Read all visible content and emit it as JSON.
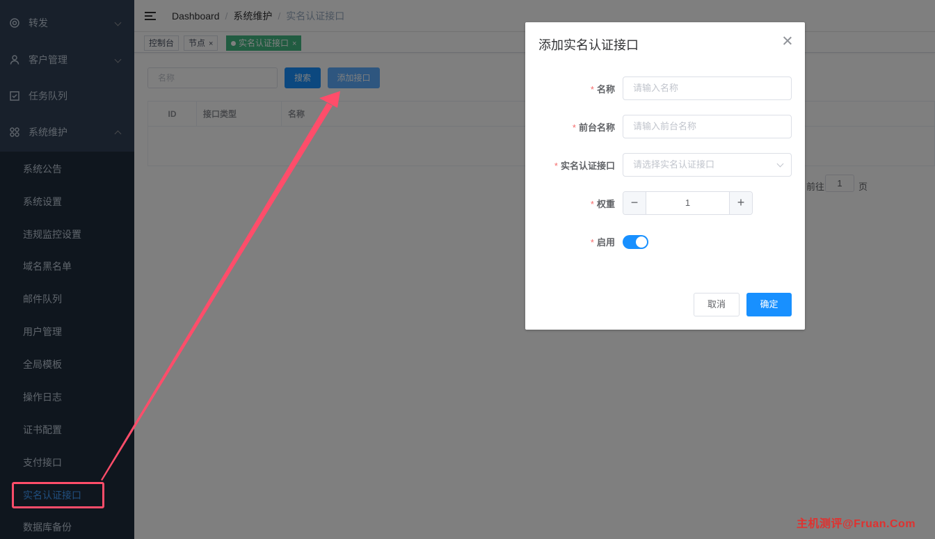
{
  "sidebar": {
    "menu": [
      {
        "label": "转发",
        "icon": "target-icon"
      },
      {
        "label": "客户管理",
        "icon": "user-icon"
      },
      {
        "label": "任务队列",
        "icon": "checkbox-icon"
      },
      {
        "label": "系统维护",
        "icon": "grid-icon"
      }
    ],
    "sub_items": [
      "系统公告",
      "系统设置",
      "违规监控设置",
      "域名黑名单",
      "邮件队列",
      "用户管理",
      "全局模板",
      "操作日志",
      "证书配置",
      "支付接口",
      "实名认证接口",
      "数据库备份"
    ],
    "active_sub": "实名认证接口"
  },
  "breadcrumb": [
    "Dashboard",
    "系统维护",
    "实名认证接口"
  ],
  "tags": [
    {
      "label": "控制台"
    },
    {
      "label": "节点",
      "close": "×"
    },
    {
      "label": "实名认证接口",
      "close": "×",
      "active": true
    }
  ],
  "filter": {
    "name_placeholder": "名称",
    "search_label": "搜索",
    "add_label": "添加接口"
  },
  "table": {
    "columns": [
      "ID",
      "接口类型",
      "名称"
    ]
  },
  "pagination": {
    "goto_label": "前往",
    "page": "1",
    "page_label": "页"
  },
  "dialog": {
    "title": "添加实名认证接口",
    "fields": {
      "name": {
        "label": "名称",
        "placeholder": "请输入名称"
      },
      "front_name": {
        "label": "前台名称",
        "placeholder": "请输入前台名称"
      },
      "interface": {
        "label": "实名认证接口",
        "placeholder": "请选择实名认证接口"
      },
      "weight": {
        "label": "权重",
        "value": "1",
        "minus": "−",
        "plus": "+"
      },
      "enabled": {
        "label": "启用",
        "on": true
      }
    },
    "required_mark": "*",
    "cancel_label": "取消",
    "ok_label": "确定"
  },
  "watermark": "主机测评@Fruan.Com",
  "colors": {
    "primary": "#1890ff",
    "sidebar": "#304156",
    "annotation": "#ff4d6a",
    "tag_active": "#42b983"
  }
}
